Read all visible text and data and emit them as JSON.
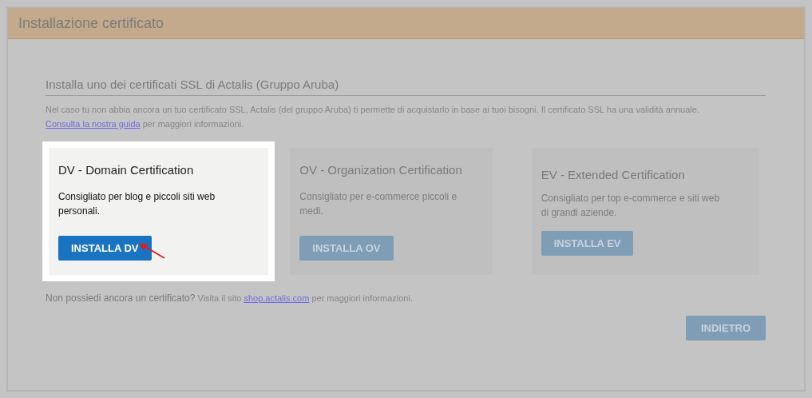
{
  "window": {
    "title": "Installazione certificato"
  },
  "section": {
    "heading": "Installa uno dei certificati SSL di Actalis (Gruppo Aruba)",
    "intro": "Nel caso tu non abbia ancora un tuo certificato SSL, Actalis (del gruppo Aruba) ti permette di acquistarlo in base ai tuoi bisogni. Il certificato SSL ha una validità annuale.",
    "guide_link": "Consulta la nostra guida",
    "guide_after": "per maggiori informazioni."
  },
  "cards": [
    {
      "title": "DV - Domain Certification",
      "description": "Consigliato per blog e piccoli siti web personali.",
      "button": "INSTALLA DV",
      "highlighted": true
    },
    {
      "title": "OV - Organization Certification",
      "description": "Consigliato per e-commerce piccoli e medi.",
      "button": "INSTALLA OV",
      "highlighted": false
    },
    {
      "title": "EV - Extended Certification",
      "description": "Consigliato per top e-commerce e siti web di grandi aziende.",
      "button": "INSTALLA EV",
      "highlighted": false
    }
  ],
  "footer": {
    "question": "Non possiedi ancora un certificato?",
    "visit": "Visita il sito",
    "link": "shop.actalis.com",
    "after": "per maggiori informazioni."
  },
  "back_button": "INDIETRO"
}
